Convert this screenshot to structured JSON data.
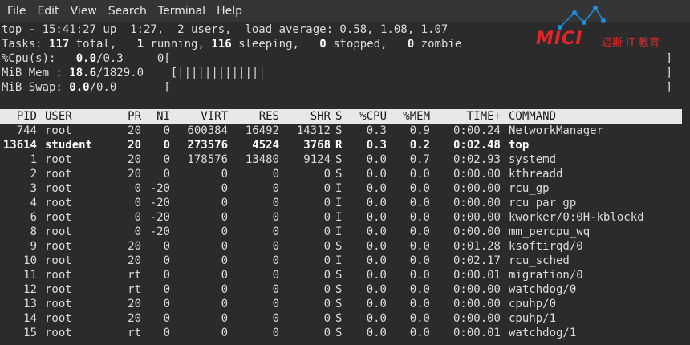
{
  "menu": [
    "File",
    "Edit",
    "View",
    "Search",
    "Terminal",
    "Help"
  ],
  "summary": {
    "top_line": "top - 15:41:27 up  1:27,  2 users,  load average: 0.58, 1.08, 1.07",
    "tasks_prefix": "Tasks: ",
    "tasks_total": "117",
    "tasks_total_label": " total,   ",
    "tasks_running": "1",
    "tasks_running_label": " running, ",
    "tasks_sleeping": "116",
    "tasks_sleeping_label": " sleeping,   ",
    "tasks_stopped": "0",
    "tasks_stopped_label": " stopped,   ",
    "tasks_zombie": "0",
    "tasks_zombie_label": " zombie",
    "cpu_prefix": "%Cpu(s):   ",
    "cpu_value": "0.0",
    "cpu_rest": "/0.3     0[",
    "mem_prefix": "MiB Mem : ",
    "mem_value": "18.6",
    "mem_rest": "/1829.0    [",
    "mem_bar": "|||||||||||||",
    "swap_prefix": "MiB Swap: ",
    "swap_value": "0.0",
    "swap_rest": "/0.0       [",
    "bracket_close": "]"
  },
  "columns": [
    "PID",
    "USER",
    "PR",
    "NI",
    "VIRT",
    "RES",
    "SHR",
    "S",
    "%CPU",
    "%MEM",
    "TIME+",
    "COMMAND"
  ],
  "processes": [
    [
      "744",
      "root",
      "20",
      "0",
      "600384",
      "16492",
      "14312",
      "S",
      "0.3",
      "0.9",
      "0:00.24",
      "NetworkManager"
    ],
    [
      "13614",
      "student",
      "20",
      "0",
      "273576",
      "4524",
      "3768",
      "R",
      "0.3",
      "0.2",
      "0:02.48",
      "top"
    ],
    [
      "1",
      "root",
      "20",
      "0",
      "178576",
      "13480",
      "9124",
      "S",
      "0.0",
      "0.7",
      "0:02.93",
      "systemd"
    ],
    [
      "2",
      "root",
      "20",
      "0",
      "0",
      "0",
      "0",
      "S",
      "0.0",
      "0.0",
      "0:00.00",
      "kthreadd"
    ],
    [
      "3",
      "root",
      "0",
      "-20",
      "0",
      "0",
      "0",
      "I",
      "0.0",
      "0.0",
      "0:00.00",
      "rcu_gp"
    ],
    [
      "4",
      "root",
      "0",
      "-20",
      "0",
      "0",
      "0",
      "I",
      "0.0",
      "0.0",
      "0:00.00",
      "rcu_par_gp"
    ],
    [
      "6",
      "root",
      "0",
      "-20",
      "0",
      "0",
      "0",
      "I",
      "0.0",
      "0.0",
      "0:00.00",
      "kworker/0:0H-kblockd"
    ],
    [
      "8",
      "root",
      "0",
      "-20",
      "0",
      "0",
      "0",
      "I",
      "0.0",
      "0.0",
      "0:00.00",
      "mm_percpu_wq"
    ],
    [
      "9",
      "root",
      "20",
      "0",
      "0",
      "0",
      "0",
      "S",
      "0.0",
      "0.0",
      "0:01.28",
      "ksoftirqd/0"
    ],
    [
      "10",
      "root",
      "20",
      "0",
      "0",
      "0",
      "0",
      "I",
      "0.0",
      "0.0",
      "0:02.17",
      "rcu_sched"
    ],
    [
      "11",
      "root",
      "rt",
      "0",
      "0",
      "0",
      "0",
      "S",
      "0.0",
      "0.0",
      "0:00.01",
      "migration/0"
    ],
    [
      "12",
      "root",
      "rt",
      "0",
      "0",
      "0",
      "0",
      "S",
      "0.0",
      "0.0",
      "0:00.00",
      "watchdog/0"
    ],
    [
      "13",
      "root",
      "20",
      "0",
      "0",
      "0",
      "0",
      "S",
      "0.0",
      "0.0",
      "0:00.00",
      "cpuhp/0"
    ],
    [
      "14",
      "root",
      "20",
      "0",
      "0",
      "0",
      "0",
      "S",
      "0.0",
      "0.0",
      "0:00.00",
      "cpuhp/1"
    ],
    [
      "15",
      "root",
      "rt",
      "0",
      "0",
      "0",
      "0",
      "S",
      "0.0",
      "0.0",
      "0:00.01",
      "watchdog/1"
    ]
  ],
  "bold_row_index": 1,
  "logo": {
    "brand": "MICI",
    "subtitle": "迈斯 IT 教育"
  },
  "colors": {
    "logo_red": "#e3262b",
    "logo_blue": "#1e8fe0",
    "header_bg": "#e8e8e8"
  }
}
